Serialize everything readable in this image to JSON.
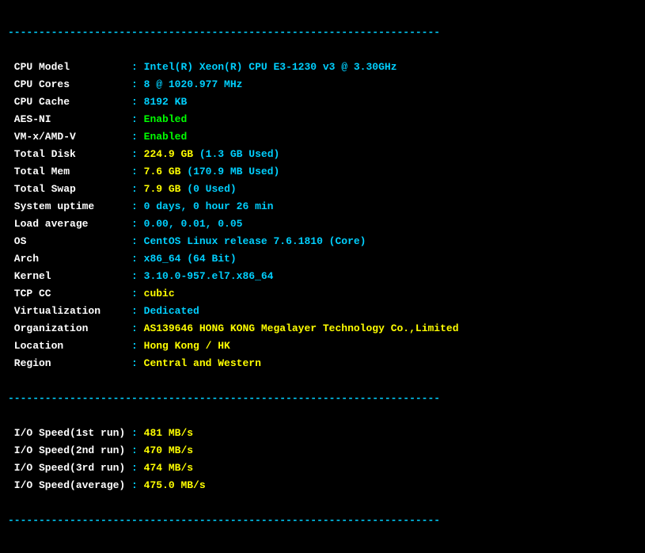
{
  "divider": "----------------------------------------------------------------------",
  "rows": [
    {
      "label": "CPU Model",
      "value": "Intel(R) Xeon(R) CPU E3-1230 v3 @ 3.30GHz",
      "cls": "cyan"
    },
    {
      "label": "CPU Cores",
      "value": "8 @ 1020.977 MHz",
      "cls": "cyan"
    },
    {
      "label": "CPU Cache",
      "value": "8192 KB",
      "cls": "cyan"
    },
    {
      "label": "AES-NI",
      "value": "Enabled",
      "cls": "green"
    },
    {
      "label": "VM-x/AMD-V",
      "value": "Enabled",
      "cls": "green"
    },
    {
      "label": "Total Disk",
      "value": "224.9 GB",
      "paren": "(1.3 GB Used)",
      "cls": "yellow"
    },
    {
      "label": "Total Mem",
      "value": "7.6 GB",
      "paren": "(170.9 MB Used)",
      "cls": "yellow"
    },
    {
      "label": "Total Swap",
      "value": "7.9 GB",
      "paren": "(0 Used)",
      "cls": "yellow"
    },
    {
      "label": "System uptime",
      "value": "0 days, 0 hour 26 min",
      "cls": "cyan"
    },
    {
      "label": "Load average",
      "value": "0.00, 0.01, 0.05",
      "cls": "cyan"
    },
    {
      "label": "OS",
      "value": "CentOS Linux release 7.6.1810 (Core)",
      "cls": "cyan"
    },
    {
      "label": "Arch",
      "value": "x86_64 (64 Bit)",
      "cls": "cyan"
    },
    {
      "label": "Kernel",
      "value": "3.10.0-957.el7.x86_64",
      "cls": "cyan"
    },
    {
      "label": "TCP CC",
      "value": "cubic",
      "cls": "yellow"
    },
    {
      "label": "Virtualization",
      "value": "Dedicated",
      "cls": "cyan"
    },
    {
      "label": "Organization",
      "value": "AS139646 HONG KONG Megalayer Technology Co.,Limited",
      "cls": "yellow"
    },
    {
      "label": "Location",
      "value": "Hong Kong / HK",
      "cls": "yellow"
    },
    {
      "label": "Region",
      "value": "Central and Western",
      "cls": "yellow"
    }
  ],
  "io": [
    {
      "label": "I/O Speed(1st run)",
      "value": "481 MB/s"
    },
    {
      "label": "I/O Speed(2nd run)",
      "value": "470 MB/s"
    },
    {
      "label": "I/O Speed(3rd run)",
      "value": "474 MB/s"
    },
    {
      "label": "I/O Speed(average)",
      "value": "475.0 MB/s"
    }
  ]
}
